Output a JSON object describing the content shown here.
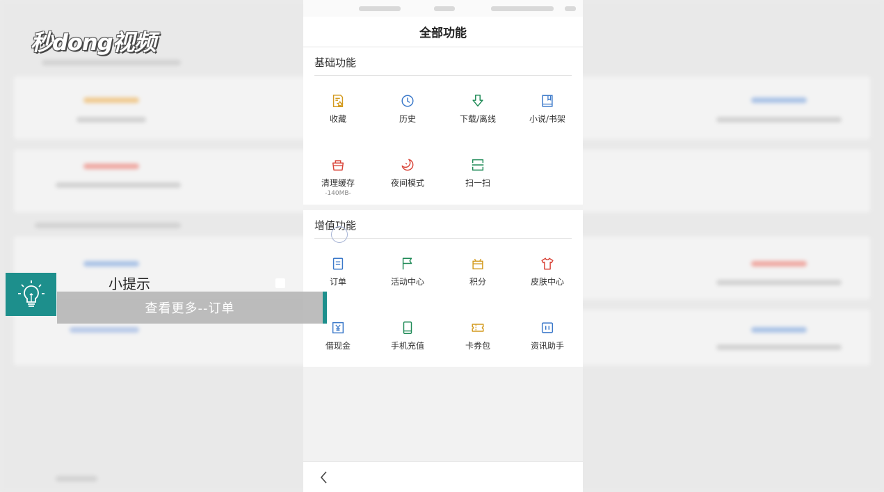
{
  "watermark": {
    "logo_text": "秒dong视频"
  },
  "header": {
    "title": "全部功能"
  },
  "basic": {
    "title": "基础功能",
    "items": [
      {
        "label": "收藏",
        "icon": "bookmark-star-icon",
        "color": "#d39a1e"
      },
      {
        "label": "历史",
        "icon": "clock-icon",
        "color": "#3a78c9"
      },
      {
        "label": "下载/离线",
        "icon": "download-icon",
        "color": "#1e8a56"
      },
      {
        "label": "小说/书架",
        "icon": "book-icon",
        "color": "#3a78c9"
      },
      {
        "label": "清理缓存",
        "sub": "-140MB-",
        "icon": "basket-icon",
        "color": "#d9453a"
      },
      {
        "label": "夜间模式",
        "icon": "moon-icon",
        "color": "#d9453a"
      },
      {
        "label": "扫一扫",
        "icon": "scan-icon",
        "color": "#1e8a56"
      }
    ]
  },
  "value_added": {
    "title": "增值功能",
    "items": [
      {
        "label": "订单",
        "icon": "order-icon",
        "color": "#3a78c9"
      },
      {
        "label": "活动中心",
        "icon": "flag-icon",
        "color": "#1e8a56"
      },
      {
        "label": "积分",
        "icon": "gift-icon",
        "color": "#d39a1e"
      },
      {
        "label": "皮肤中心",
        "icon": "shirt-icon",
        "color": "#d9453a"
      },
      {
        "label": "借现金",
        "icon": "cash-icon",
        "color": "#3a78c9"
      },
      {
        "label": "手机充值",
        "icon": "phone-icon",
        "color": "#1e8a56"
      },
      {
        "label": "卡券包",
        "icon": "ticket-icon",
        "color": "#d39a1e"
      },
      {
        "label": "资讯助手",
        "icon": "news-icon",
        "color": "#3a78c9"
      }
    ]
  },
  "tip": {
    "title": "小提示",
    "text": "查看更多--订单",
    "accent": "#1d8f8c"
  },
  "footer": {
    "back_icon": "chevron-left-icon"
  }
}
